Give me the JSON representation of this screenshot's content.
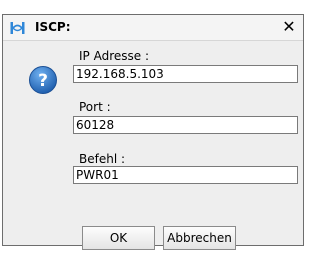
{
  "window": {
    "title": "ISCP:",
    "close_glyph": "✕"
  },
  "icons": {
    "app": "iscp-app-icon",
    "info": "question-icon",
    "close": "close-icon"
  },
  "form": {
    "ip_label": "IP Adresse :",
    "ip_value": "192.168.5.103",
    "port_label": "Port :",
    "port_value": "60128",
    "command_label": "Befehl :",
    "command_value": "PWR01"
  },
  "buttons": {
    "ok_label": "OK",
    "cancel_label": "Abbrechen"
  },
  "colors": {
    "icon_blue": "#2a74c9",
    "app_icon_blue": "#2f87d8"
  }
}
